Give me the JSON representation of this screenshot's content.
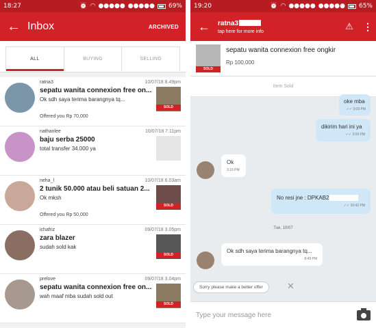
{
  "left": {
    "status": {
      "time": "18:27",
      "battery": "69%"
    },
    "appbar": {
      "title": "Inbox",
      "archived": "ARCHIVED"
    },
    "tabs": [
      "ALL",
      "BUYING",
      "SELLING"
    ],
    "conversations": [
      {
        "user": "ratna3",
        "date": "10/07/18 8.49pm",
        "subject": "sepatu wanita connexion free on...",
        "preview": "Ok sdh saya terima barangnya tq...",
        "offer": "Offered you Rp 70,000",
        "sold": "SOLD",
        "avatar_color": "#7b96a8",
        "thumb_color": "#8d7a62"
      },
      {
        "user": "nathanlee",
        "date": "10/07/18 7.11pm",
        "subject": "baju serba 25000",
        "preview": "total transfer 34.000 ya",
        "offer": "",
        "sold": "",
        "avatar_color": "#c894c8",
        "thumb_color": "#e6e6e6"
      },
      {
        "user": "neha_l",
        "date": "10/07/18 6.03am",
        "subject": "2 tunik 50.000 atau beli satuan 2...",
        "preview": "Ok mksh",
        "offer": "Offered you Rp 50,000",
        "sold": "SOLD",
        "avatar_color": "#c9a89a",
        "thumb_color": "#6d4c4a"
      },
      {
        "user": "ichafriz",
        "date": "09/07/18 3.05pm",
        "subject": "zara blazer",
        "preview": "sudah sold kak",
        "offer": "",
        "sold": "SOLD",
        "avatar_color": "#8a6e62",
        "thumb_color": "#575757"
      },
      {
        "user": "prelove",
        "date": "09/07/18 3.04pm",
        "subject": "sepatu wanita connexion free on...",
        "preview": "wah maaf mba sudah sold out",
        "offer": "",
        "sold": "SOLD",
        "avatar_color": "#a7998f",
        "thumb_color": "#8d7a62"
      }
    ]
  },
  "right": {
    "status": {
      "time": "19:20",
      "battery": "65%"
    },
    "appbar": {
      "name": "ratna3",
      "hint": "tap here for more info"
    },
    "product": {
      "title": "sepatu wanita connexion free ongkir",
      "price": "Rp 100,000",
      "sold": "SOLD"
    },
    "item_sold": "Item Sold",
    "messages": {
      "m1": {
        "text": "oke mba",
        "time": "3:09 PM"
      },
      "m2": {
        "text": "dikirim hari ini ya",
        "time": "3:09 PM"
      },
      "m3": {
        "text": "Ok",
        "time": "3:16 PM"
      },
      "m4": {
        "text": "No resi jne : DPKAB2",
        "time": "10:42 PM"
      },
      "day": "Tue, 10/07",
      "m5": {
        "text": "Ok sdh saya terima barangnya tq...",
        "time": "8:49 PM"
      }
    },
    "quick_reply": "Sorry please make a better offer",
    "compose_placeholder": "Type your message here"
  }
}
